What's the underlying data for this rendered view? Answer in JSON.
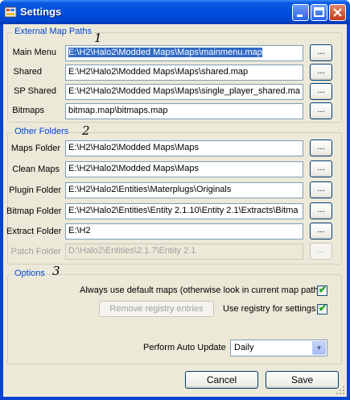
{
  "window": {
    "title": "Settings"
  },
  "external_paths": {
    "title": "External Map Paths",
    "marker": "1",
    "rows": [
      {
        "label": "Main Menu",
        "value": "E:\\H2\\Halo2\\Modded Maps\\Maps\\mainmenu.map",
        "browse": "..."
      },
      {
        "label": "Shared",
        "value": "E:\\H2\\Halo2\\Modded Maps\\Maps\\shared.map",
        "browse": "..."
      },
      {
        "label": "SP Shared",
        "value": "E:\\H2\\Halo2\\Modded Maps\\Maps\\single_player_shared.ma",
        "browse": "..."
      },
      {
        "label": "Bitmaps",
        "value": "bitmap.map\\bitmaps.map",
        "browse": "..."
      }
    ]
  },
  "other_folders": {
    "title": "Other Folders",
    "marker": "2",
    "rows": [
      {
        "label": "Maps Folder",
        "value": "E:\\H2\\Halo2\\Modded Maps\\Maps",
        "browse": "..."
      },
      {
        "label": "Clean Maps",
        "value": "E:\\H2\\Halo2\\Modded Maps\\Maps",
        "browse": "..."
      },
      {
        "label": "Plugin Folder",
        "value": "E:\\H2\\Halo2\\Entities\\Materplugs\\Originals",
        "browse": "..."
      },
      {
        "label": "Bitmap Folder",
        "value": "E:\\H2\\Halo2\\Entities\\Entity 2.1.10\\Entity 2.1\\Extracts\\Bitma",
        "browse": "..."
      },
      {
        "label": "Extract Folder",
        "value": "E:\\H2",
        "browse": "..."
      },
      {
        "label": "Patch Folder",
        "value": "D:\\Halo2\\Entities\\2.1.7\\Entity 2.1",
        "browse": "..."
      }
    ]
  },
  "options": {
    "title": "Options",
    "marker": "3",
    "always_default_label": "Always use default maps (otherwise look in current map path)",
    "always_default_checked": true,
    "remove_registry_label": "Remove registry entries",
    "use_registry_label": "Use registry for settings",
    "use_registry_checked": true,
    "auto_update_label": "Perform Auto Update",
    "auto_update_value": "Daily"
  },
  "footer": {
    "cancel_label": "Cancel",
    "save_label": "Save"
  },
  "colors": {
    "title_blue": "#0050e0",
    "group_title": "#0046d5",
    "dialog_bg": "#ece9d8",
    "selection": "#316ac5"
  }
}
